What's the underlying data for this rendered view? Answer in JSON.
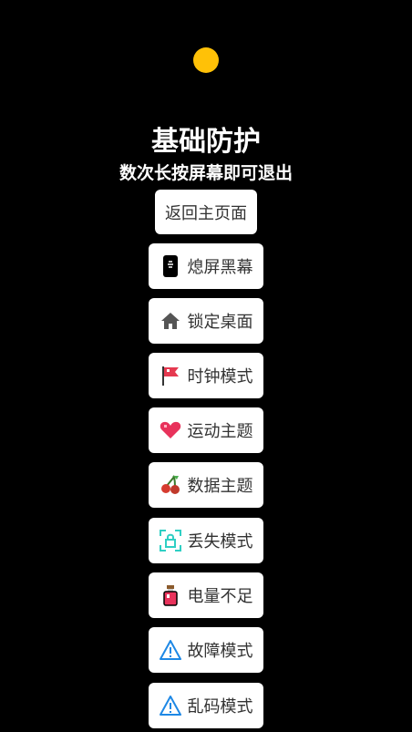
{
  "colors": {
    "background": "#000000",
    "status_dot": "#FFC107",
    "button_bg": "#ffffff",
    "button_text": "#333333"
  },
  "header": {
    "title": "基础防护",
    "subtitle": "数次长按屏幕即可退出"
  },
  "back_button": {
    "label": "返回主页面"
  },
  "modes": [
    {
      "label": "熄屏黑幕",
      "icon": "phone-icon"
    },
    {
      "label": "锁定桌面",
      "icon": "home-icon"
    },
    {
      "label": "时钟模式",
      "icon": "flag-icon"
    },
    {
      "label": "运动主题",
      "icon": "heart-icon"
    },
    {
      "label": "数据主题",
      "icon": "cherry-icon"
    },
    {
      "label": "丢失模式",
      "icon": "lock-scan-icon"
    },
    {
      "label": "电量不足",
      "icon": "potion-icon"
    },
    {
      "label": "故障模式",
      "icon": "warning-icon"
    },
    {
      "label": "乱码模式",
      "icon": "warning-icon"
    }
  ]
}
